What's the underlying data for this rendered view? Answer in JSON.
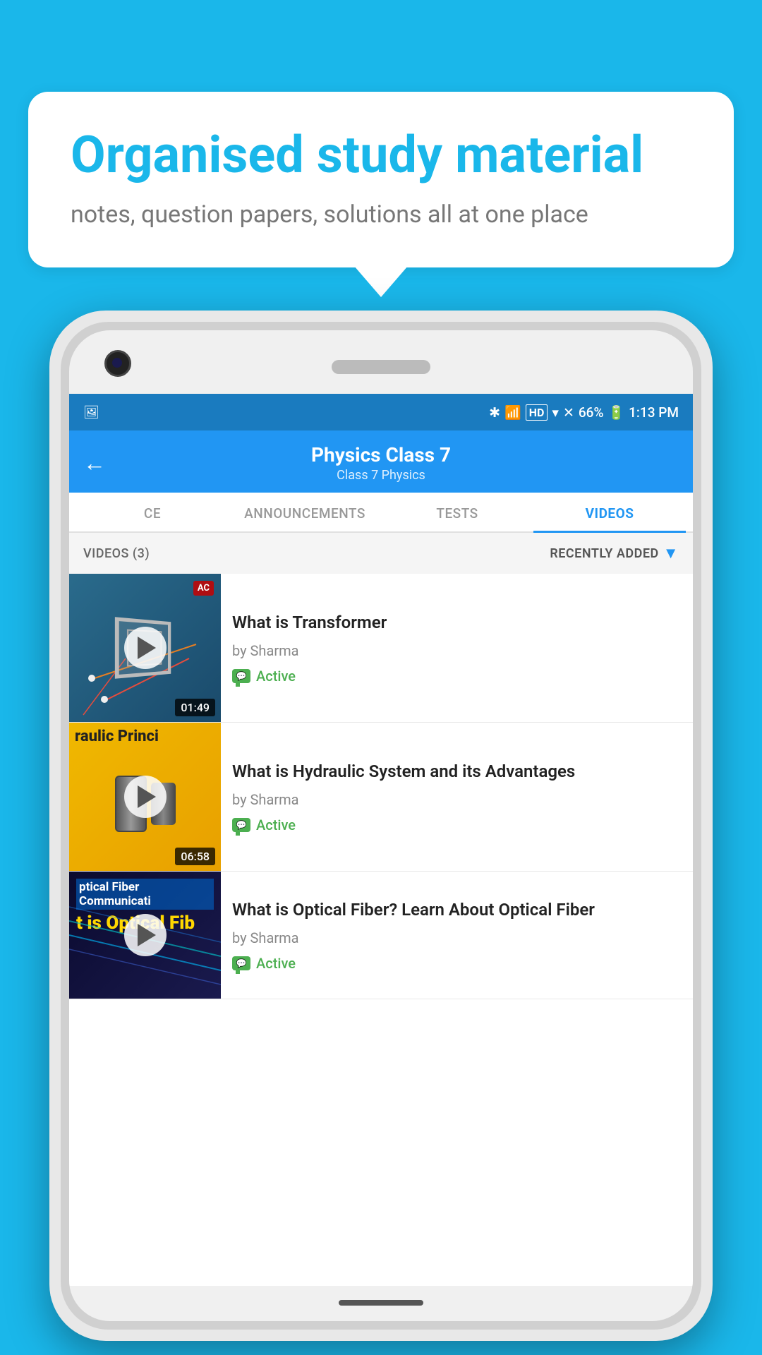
{
  "background_color": "#1ab7ea",
  "promo": {
    "title": "Organised study material",
    "subtitle": "notes, question papers, solutions all at one place"
  },
  "status_bar": {
    "battery": "66%",
    "time": "1:13 PM",
    "signal_icons": "▲▲ HD ▼ ✕"
  },
  "header": {
    "title": "Physics Class 7",
    "breadcrumb": "Class 7   Physics",
    "back_label": "←"
  },
  "tabs": [
    {
      "id": "ce",
      "label": "CE",
      "active": false
    },
    {
      "id": "announcements",
      "label": "ANNOUNCEMENTS",
      "active": false
    },
    {
      "id": "tests",
      "label": "TESTS",
      "active": false
    },
    {
      "id": "videos",
      "label": "VIDEOS",
      "active": true
    }
  ],
  "filter_bar": {
    "count_label": "VIDEOS (3)",
    "sort_label": "RECENTLY ADDED",
    "chevron": "▼"
  },
  "videos": [
    {
      "title": "What is  Transformer",
      "author": "by Sharma",
      "status": "Active",
      "duration": "01:49",
      "thumb_label": "AC",
      "thumb_type": "transformer"
    },
    {
      "title": "What is Hydraulic System and its Advantages",
      "author": "by Sharma",
      "status": "Active",
      "duration": "06:58",
      "thumb_label": "",
      "thumb_type": "hydraulic"
    },
    {
      "title": "What is Optical Fiber? Learn About Optical Fiber",
      "author": "by Sharma",
      "status": "Active",
      "duration": "",
      "thumb_label": "",
      "thumb_type": "fiber"
    }
  ],
  "icons": {
    "play": "▶",
    "chat": "💬",
    "back": "←"
  }
}
